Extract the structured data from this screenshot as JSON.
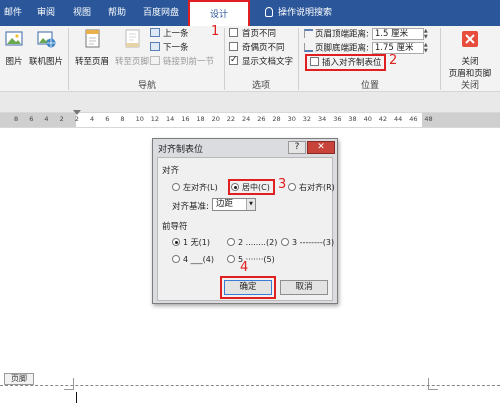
{
  "tabs": {
    "mail": "邮件",
    "review": "审阅",
    "view": "视图",
    "help": "帮助",
    "baidu": "百度网盘",
    "design": "设计",
    "search": "操作说明搜索"
  },
  "ribbon": {
    "insert_group": {
      "picture": "图片",
      "online_picture": "联机图片"
    },
    "nav_group": {
      "goto_header": "转至页眉",
      "goto_footer": "转至页脚",
      "previous": "上一条",
      "next": "下一条",
      "link_previous": "链接到前一节",
      "label": "导航"
    },
    "options_group": {
      "diff_first": "首页不同",
      "diff_odd_even": "奇偶页不同",
      "show_text": "显示文档文字",
      "label": "选项"
    },
    "position_group": {
      "header_from_top_label": "页眉顶端距离:",
      "header_from_top_value": "1.5 厘米",
      "footer_from_bottom_label": "页脚底端距离:",
      "footer_from_bottom_value": "1.75 厘米",
      "insert_align_tab": "插入对齐制表位",
      "label": "位置"
    },
    "close_group": {
      "close_line1": "关闭",
      "close_line2": "页眉和页脚",
      "label": "关闭"
    }
  },
  "ruler": {
    "ticks": [
      "8",
      "6",
      "4",
      "2",
      "2",
      "4",
      "6",
      "8",
      "10",
      "12",
      "14",
      "16",
      "18",
      "20",
      "22",
      "24",
      "26",
      "28",
      "30",
      "32",
      "34",
      "36",
      "38",
      "40",
      "42",
      "44",
      "46",
      "48"
    ]
  },
  "dialog": {
    "title": "对齐制表位",
    "help": "?",
    "close": "✕",
    "align_section": "对齐",
    "align_left": "左对齐(L)",
    "align_center": "居中(C)",
    "align_right": "右对齐(R)",
    "align_relative_label": "对齐基准:",
    "align_relative_value": "边距",
    "leader_section": "前导符",
    "leader_1": "1 无(1)",
    "leader_2": "2 ........(2)",
    "leader_3": "3 --------(3)",
    "leader_4": "4 ___(4)",
    "leader_5": "5 ·······(5)",
    "ok": "确定",
    "cancel": "取消"
  },
  "annotations": {
    "n1": "1",
    "n2": "2",
    "n3": "3",
    "n4": "4"
  },
  "footer": {
    "tag": "页脚"
  },
  "colors": {
    "ribbon_blue": "#2b579a",
    "annotation_red": "#e02020"
  }
}
